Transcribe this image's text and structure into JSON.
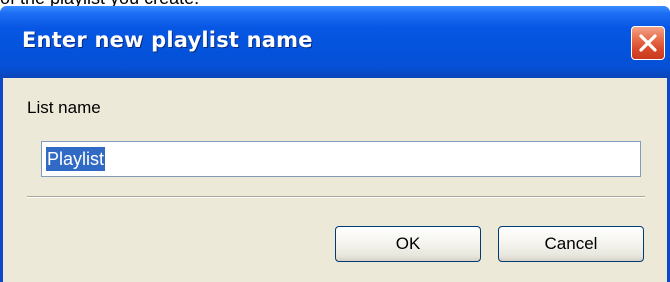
{
  "background": {
    "text": "of the playlist you create."
  },
  "dialog": {
    "title": "Enter new playlist name",
    "label": "List name",
    "input_value": "Playlist",
    "ok_label": "OK",
    "cancel_label": "Cancel"
  },
  "colors": {
    "titlebar": "#0553DC",
    "client": "#ECE9D8",
    "selection": "#316AC5",
    "close_button": "#D9482A"
  },
  "icons": {
    "close": "close-icon"
  }
}
